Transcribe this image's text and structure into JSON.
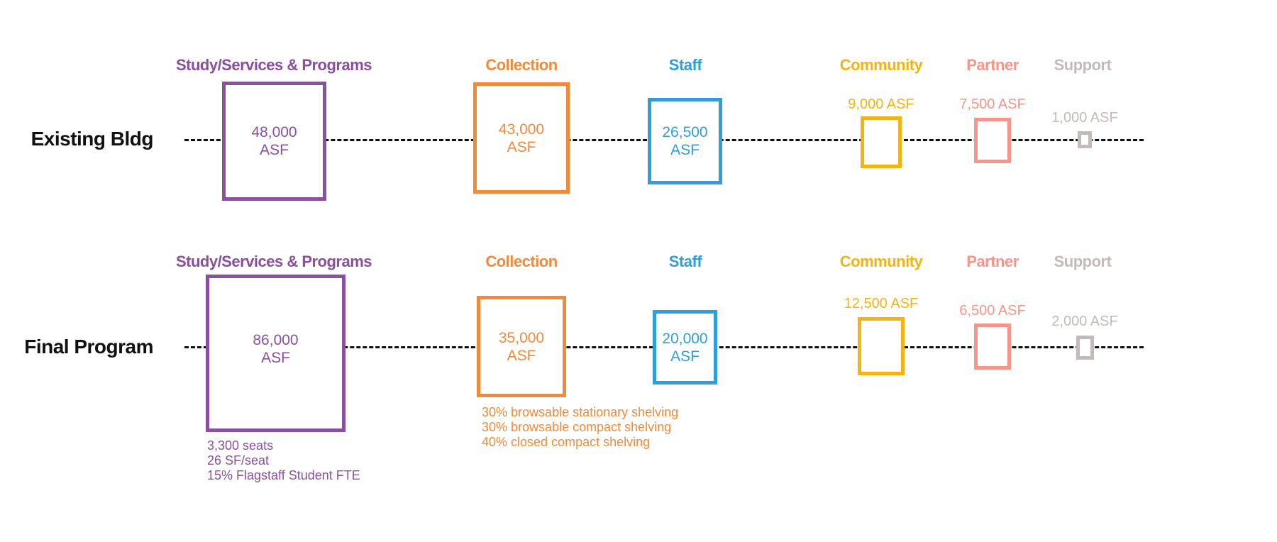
{
  "colors": {
    "study": "#8a4f9e",
    "collection": "#f28a3a",
    "staff": "#2e9fd8",
    "community": "#f2b413",
    "partner": "#f4968a",
    "support": "#c4bab7",
    "line": "#111111"
  },
  "categories": [
    "Study/Services & Programs",
    "Collection",
    "Staff",
    "Community",
    "Partner",
    "Support"
  ],
  "rows": [
    {
      "label": "Existing Bldg",
      "items": [
        {
          "category": "Study/Services & Programs",
          "value": "48,000",
          "unit": "ASF",
          "asf": 48000
        },
        {
          "category": "Collection",
          "value": "43,000",
          "unit": "ASF",
          "asf": 43000
        },
        {
          "category": "Staff",
          "value": "26,500",
          "unit": "ASF",
          "asf": 26500
        },
        {
          "category": "Community",
          "value_label": "9,000 ASF",
          "asf": 9000
        },
        {
          "category": "Partner",
          "value_label": "7,500 ASF",
          "asf": 7500
        },
        {
          "category": "Support",
          "value_label": "1,000 ASF",
          "asf": 1000
        }
      ]
    },
    {
      "label": "Final Program",
      "items": [
        {
          "category": "Study/Services & Programs",
          "value": "86,000",
          "unit": "ASF",
          "asf": 86000,
          "notes": [
            "3,300 seats",
            "26 SF/seat",
            "15% Flagstaff Student FTE"
          ]
        },
        {
          "category": "Collection",
          "value": "35,000",
          "unit": "ASF",
          "asf": 35000,
          "notes": [
            "30% browsable stationary shelving",
            "30% browsable compact shelving",
            "40% closed compact shelving"
          ]
        },
        {
          "category": "Staff",
          "value": "20,000",
          "unit": "ASF",
          "asf": 20000
        },
        {
          "category": "Community",
          "value_label": "12,500 ASF",
          "asf": 12500
        },
        {
          "category": "Partner",
          "value_label": "6,500 ASF",
          "asf": 6500
        },
        {
          "category": "Support",
          "value_label": "2,000 ASF",
          "asf": 2000
        }
      ]
    }
  ]
}
